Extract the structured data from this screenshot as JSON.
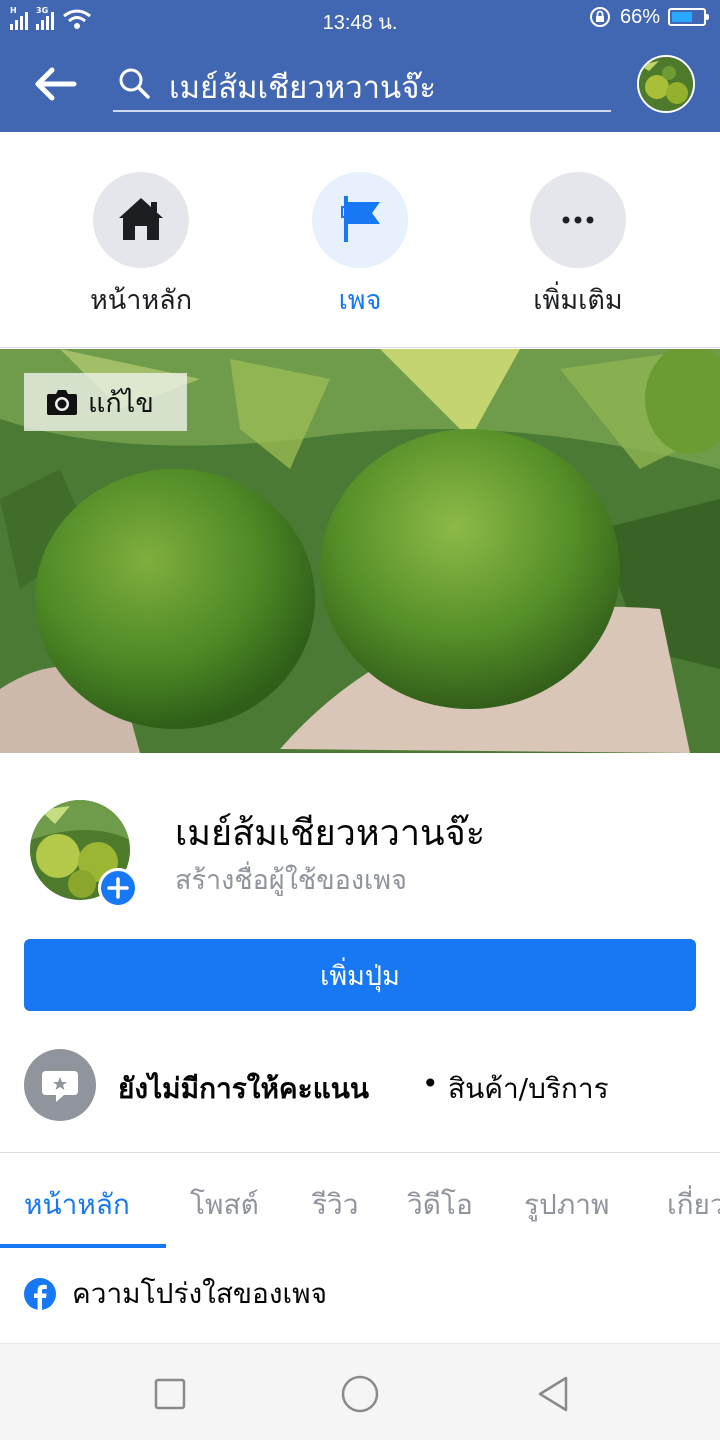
{
  "status_bar": {
    "time": "13:48 น.",
    "battery": "66%",
    "battery_level": 0.66,
    "network_label": "3G"
  },
  "header": {
    "search_text": "เมย์ส้มเชียวหวานจ๊ะ"
  },
  "modes": [
    {
      "label": "หน้าหลัก",
      "icon": "home-icon",
      "active": false
    },
    {
      "label": "เพจ",
      "icon": "flag-icon",
      "active": true
    },
    {
      "label": "เพิ่มเติม",
      "icon": "more-icon",
      "active": false
    }
  ],
  "cover": {
    "edit_label": "แก้ไข"
  },
  "profile": {
    "name": "เมย์ส้มเชียวหวานจ๊ะ",
    "username_prompt": "สร้างชื่อผู้ใช้ของเพจ"
  },
  "actions": {
    "add_button": "เพิ่มปุ่ม"
  },
  "rating": {
    "text": "ยังไม่มีการให้คะแนน",
    "separator": "•",
    "category": "สินค้า/บริการ"
  },
  "tabs": [
    "หน้าหลัก",
    "โพสต์",
    "รีวิว",
    "วิดีโอ",
    "รูปภาพ",
    "เกี่ยวกับ"
  ],
  "transparency": {
    "label": "ความโปร่งใสของเพจ"
  },
  "colors": {
    "header": "#4167b2",
    "accent": "#1877f2",
    "muted": "#90949c"
  }
}
